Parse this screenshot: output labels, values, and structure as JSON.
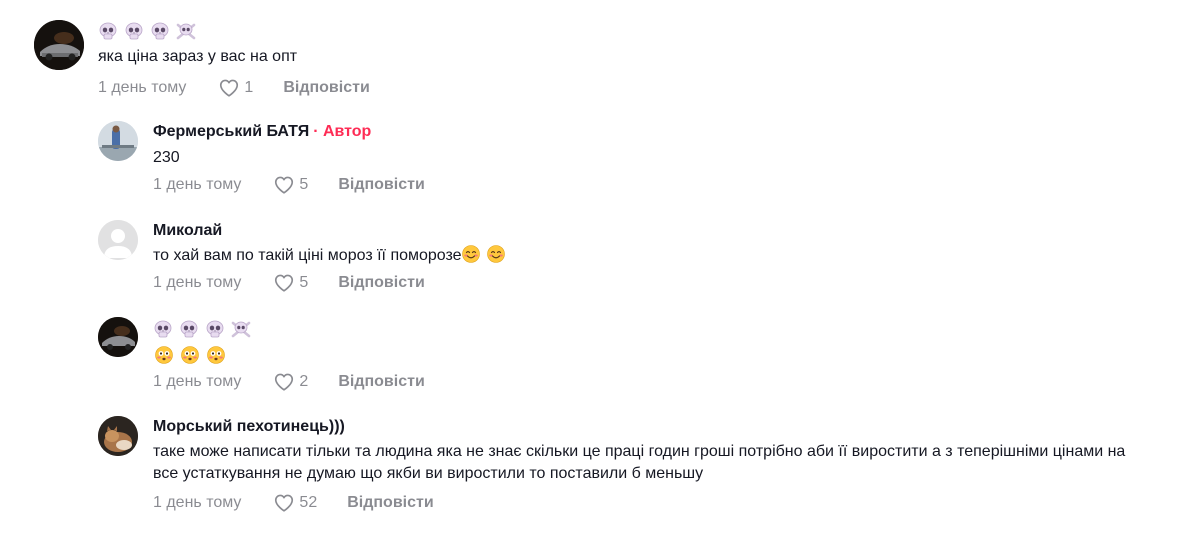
{
  "comments": [
    {
      "author": "",
      "author_badge": "",
      "name_icons": [
        "skull-emoji",
        "skull-emoji",
        "skull-emoji",
        "skull-crossbones-emoji"
      ],
      "text": "яка ціна зараз у вас на опт",
      "date": "1 день тому",
      "likes": "1",
      "reply": "Відповісти"
    },
    {
      "author": "Фермерський БАТЯ",
      "author_badge": "· Автор",
      "text": "230",
      "date": "1 день тому",
      "likes": "5",
      "reply": "Відповісти"
    },
    {
      "author": "Миколай",
      "text": "то хай вам по такій ціні мороз її поморозе",
      "text_emojis": [
        "smiling-face-emoji",
        "smiling-face-emoji"
      ],
      "date": "1 день тому",
      "likes": "5",
      "reply": "Відповісти"
    },
    {
      "author": "",
      "name_icons": [
        "skull-emoji",
        "skull-emoji",
        "skull-emoji",
        "skull-crossbones-emoji"
      ],
      "text_emojis": [
        "flushed-face-emoji",
        "flushed-face-emoji",
        "flushed-face-emoji"
      ],
      "date": "1 день тому",
      "likes": "2",
      "reply": "Відповісти"
    },
    {
      "author": "Морський пехотинець)))",
      "text": "таке може написати тільки та людина яка не знає скільки це праці годин гроші потрібно аби її виростити а з теперішніми цінами на все устаткування не думаю що якби ви виростили то поставили б меньшу",
      "date": "1 день тому",
      "likes": "52",
      "reply": "Відповісти"
    }
  ],
  "colors": {
    "text": "#161823",
    "muted": "rgba(22,24,35,0.5)",
    "author_badge": "#fe2c55",
    "skull": "#e6d7f0"
  }
}
